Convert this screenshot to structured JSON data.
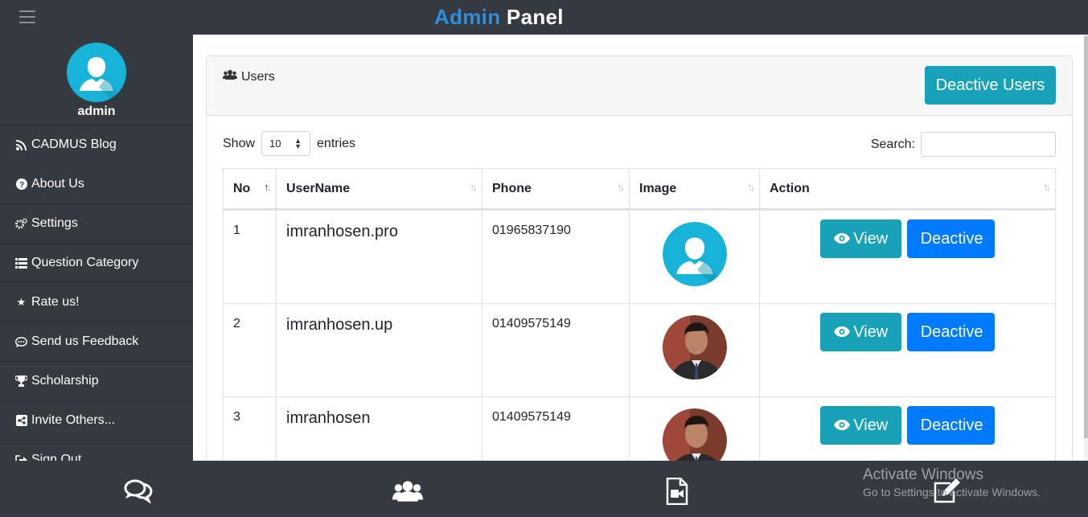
{
  "header": {
    "brand_part1": "Admin",
    "brand_part2": "Panel",
    "accent_color": "#2f8fd8",
    "bg_color": "#343a40"
  },
  "sidebar": {
    "profile_name": "admin",
    "items": [
      {
        "label": "CADMUS Blog",
        "icon": "rss-icon"
      },
      {
        "label": "About Us",
        "icon": "question-circle-icon"
      },
      {
        "label": "Settings",
        "icon": "cogs-icon"
      },
      {
        "label": "Question Category",
        "icon": "list-icon"
      },
      {
        "label": "Rate us!",
        "icon": "star-icon"
      },
      {
        "label": "Send us Feedback",
        "icon": "comment-dots-icon"
      },
      {
        "label": "Scholarship",
        "icon": "trophy-icon"
      },
      {
        "label": "Invite Others...",
        "icon": "share-icon"
      },
      {
        "label": "Sign Out",
        "icon": "sign-out-icon"
      }
    ]
  },
  "card": {
    "title": "Users",
    "deactive_users_label": "Deactive Users",
    "show_label": "Show",
    "entries_value": "10",
    "entries_label": "entries",
    "search_label": "Search:"
  },
  "table": {
    "headers": [
      "No",
      "UserName",
      "Phone",
      "Image",
      "Action"
    ],
    "rows": [
      {
        "no": "1",
        "username": "imranhosen.pro",
        "phone": "01965837190",
        "image": "default-avatar"
      },
      {
        "no": "2",
        "username": "imranhosen.up",
        "phone": "01409575149",
        "image": "user-photo"
      },
      {
        "no": "3",
        "username": "imranhosen",
        "phone": "01409575149",
        "image": "user-photo"
      }
    ],
    "view_label": "View",
    "deactive_label": "Deactive"
  },
  "bottom_nav": {
    "icons": [
      "comments-icon",
      "users-icon",
      "video-file-icon",
      "edit-icon"
    ]
  },
  "watermark": {
    "line1": "Activate Windows",
    "line2": "Go to Settings to activate Windows."
  }
}
